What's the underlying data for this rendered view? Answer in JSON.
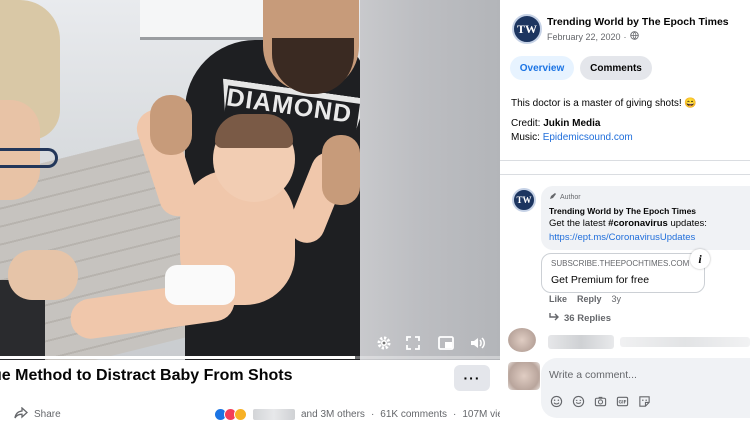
{
  "video": {
    "controls": [
      "gear-icon",
      "expand-icon",
      "pip-icon",
      "volume-icon"
    ],
    "progress": 0.71,
    "shirt_print": "DIAMOND"
  },
  "post": {
    "title": "ue Method to Distract Baby From Shots",
    "more_label": "···",
    "share_label": "Share",
    "reactions_text": "and 3M others",
    "comments_count": "61K comments",
    "views_count": "107M views",
    "separator": "·"
  },
  "panel": {
    "page_name": "Trending World by The Epoch Times",
    "avatar_text": "TW",
    "date": "February 22, 2020",
    "date_sep": "·",
    "tabs": [
      {
        "label": "Overview",
        "active": true
      },
      {
        "label": "Comments",
        "active": false
      }
    ],
    "caption": "This doctor is a master of giving shots! 😄",
    "credit_label": "Credit:",
    "credit_value": "Jukin Media",
    "music_label": "Music:",
    "music_value": "Epidemicsound.com"
  },
  "comment": {
    "avatar_text": "TW",
    "badge": "Author",
    "author": "Trending World by The Epoch Times",
    "text_prefix": "Get the latest ",
    "hashtag": "#coronavirus",
    "text_suffix": " updates:",
    "link": "https://ept.ms/CoronavirusUpdates",
    "card_domain": "SUBSCRIBE.THEEPOCHTIMES.COM",
    "card_title": "Get Premium for free",
    "card_info_icon": "i",
    "like": "Like",
    "reply": "Reply",
    "time": "3y",
    "replies": "36 Replies"
  },
  "compose": {
    "placeholder": "Write a comment...",
    "icons": [
      "emoji-icon",
      "smiley-icon",
      "camera-icon",
      "gif-icon",
      "sticker-icon"
    ]
  },
  "colors": {
    "accent": "#1b74e4",
    "link": "#216fdb",
    "secondary_text": "#65676b",
    "bubble_bg": "#f0f2f5",
    "avatar_bg": "#1c3560"
  }
}
